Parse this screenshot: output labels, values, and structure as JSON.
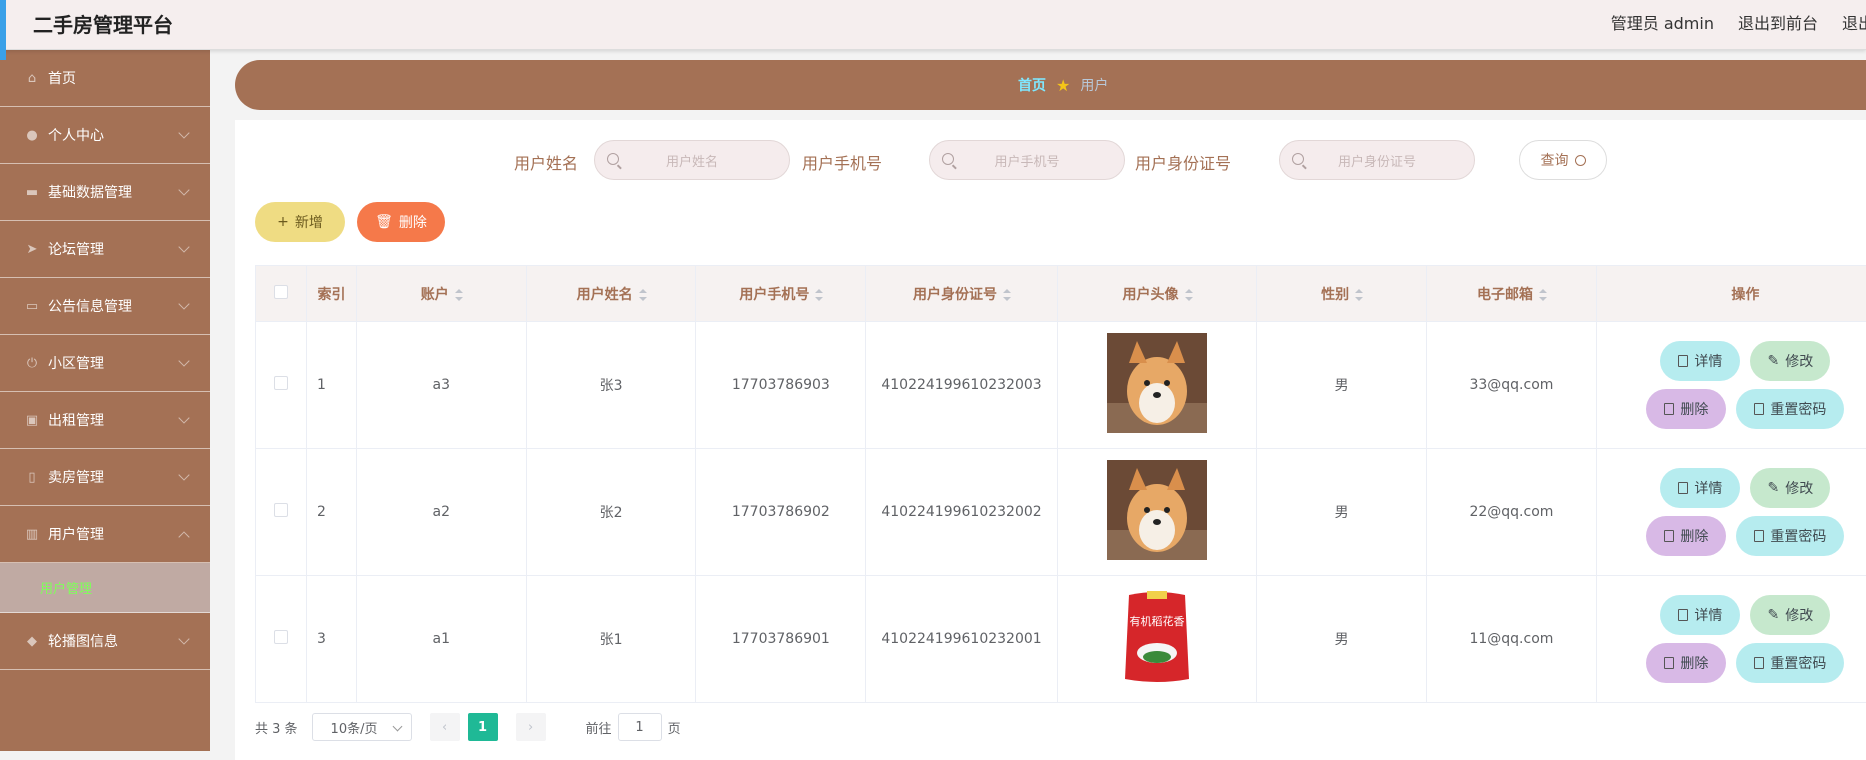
{
  "header": {
    "title": "二手房管理平台",
    "admin": "管理员 admin",
    "to_front": "退出到前台",
    "logout": "退出登录"
  },
  "sidebar": {
    "items": [
      {
        "label": "首页",
        "icon": "home-icon"
      },
      {
        "label": "个人中心",
        "icon": "user-icon"
      },
      {
        "label": "基础数据管理",
        "icon": "chat-icon"
      },
      {
        "label": "论坛管理",
        "icon": "send-icon"
      },
      {
        "label": "公告信息管理",
        "icon": "message-icon"
      },
      {
        "label": "小区管理",
        "icon": "power-icon"
      },
      {
        "label": "出租管理",
        "icon": "briefcase-icon"
      },
      {
        "label": "卖房管理",
        "icon": "phone-icon"
      },
      {
        "label": "用户管理",
        "icon": "trash-icon"
      },
      {
        "label": "轮播图信息",
        "icon": "shield-icon"
      }
    ],
    "active_sub": "用户管理"
  },
  "breadcrumb": {
    "home": "首页",
    "current": "用户"
  },
  "search": {
    "name_label": "用户姓名",
    "name_placeholder": "用户姓名",
    "phone_label": "用户手机号",
    "phone_placeholder": "用户手机号",
    "id_label": "用户身份证号",
    "id_placeholder": "用户身份证号",
    "query": "查询"
  },
  "actions": {
    "add": "新增",
    "delete": "删除"
  },
  "table": {
    "headers": [
      "索引",
      "账户",
      "用户姓名",
      "用户手机号",
      "用户身份证号",
      "用户头像",
      "性别",
      "电子邮箱",
      "操作"
    ],
    "rows": [
      {
        "index": "1",
        "account": "a3",
        "name": "张3",
        "phone": "17703786903",
        "idno": "410224199610232003",
        "avatar": "dog",
        "gender": "男",
        "email": "33@qq.com"
      },
      {
        "index": "2",
        "account": "a2",
        "name": "张2",
        "phone": "17703786902",
        "idno": "410224199610232002",
        "avatar": "dog",
        "gender": "男",
        "email": "22@qq.com"
      },
      {
        "index": "3",
        "account": "a1",
        "name": "张1",
        "phone": "17703786901",
        "idno": "410224199610232001",
        "avatar": "rice-bag",
        "gender": "男",
        "email": "11@qq.com"
      }
    ],
    "ops": {
      "detail": "详情",
      "edit": "修改",
      "delete": "删除",
      "reset": "重置密码"
    }
  },
  "rice_bag_text": "有机稻花香",
  "pager": {
    "total": "共 3 条",
    "size": "10条/页",
    "page": "1",
    "goto": "前往",
    "goto_value": "1",
    "page_unit": "页"
  }
}
